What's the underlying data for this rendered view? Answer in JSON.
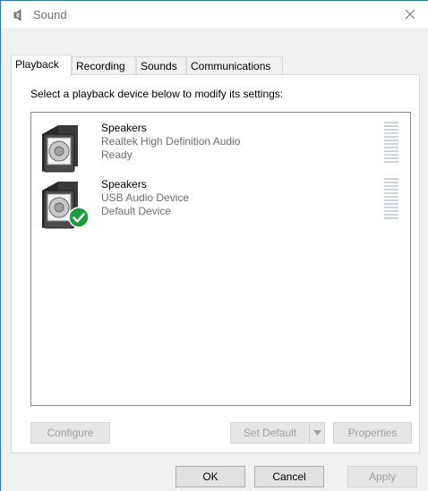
{
  "window": {
    "title": "Sound",
    "icon": "speaker-icon",
    "close_icon": "close-icon"
  },
  "tabs": [
    {
      "label": "Playback",
      "active": true
    },
    {
      "label": "Recording",
      "active": false
    },
    {
      "label": "Sounds",
      "active": false
    },
    {
      "label": "Communications",
      "active": false
    }
  ],
  "playback": {
    "instruction": "Select a playback device below to modify its settings:",
    "devices": [
      {
        "name": "Speakers",
        "description": "Realtek High Definition Audio",
        "status": "Ready",
        "icon": "speaker-device-icon",
        "is_default": false
      },
      {
        "name": "Speakers",
        "description": "USB Audio Device",
        "status": "Default Device",
        "icon": "speaker-device-icon",
        "is_default": true,
        "badge_icon": "checkmark-icon"
      }
    ],
    "buttons": {
      "configure": "Configure",
      "set_default": "Set Default",
      "properties": "Properties"
    }
  },
  "dialog_buttons": {
    "ok": "OK",
    "cancel": "Cancel",
    "apply": "Apply"
  },
  "colors": {
    "window_border": "#2b79c6",
    "default_badge": "#1b9e3e",
    "level_meter": "#c9d6dc"
  }
}
